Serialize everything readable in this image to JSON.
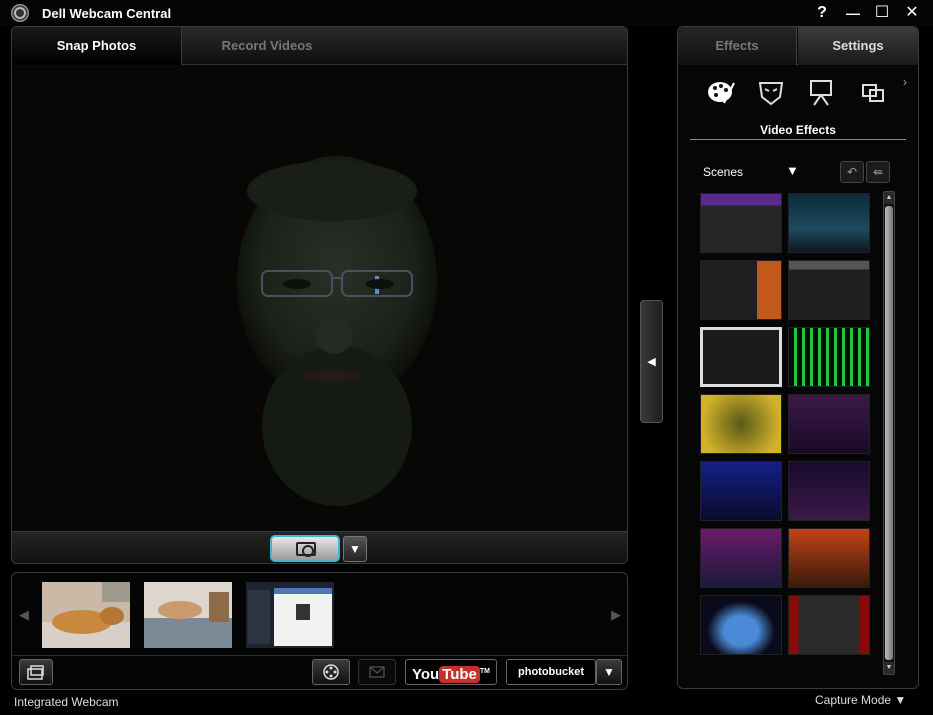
{
  "window": {
    "title": "Dell Webcam Central",
    "controls": [
      "?",
      "—",
      "☐",
      "✕"
    ]
  },
  "capture": {
    "tabs": [
      {
        "label": "Snap Photos"
      },
      {
        "label": "Record Videos"
      }
    ],
    "snap_dropdown": "▼"
  },
  "gallery": {
    "prev_arrow": "◀",
    "next_arrow": "▶",
    "youtube_you": "You",
    "youtube_tube": "Tube",
    "youtube_tm": "TM",
    "photobucket_label": "photobucket",
    "share_dropdown": "▼"
  },
  "collapse_arrow": "◀",
  "effects": {
    "tabs": [
      {
        "label": "Effects"
      },
      {
        "label": "Settings"
      }
    ],
    "more_arrow": "›",
    "section_title": "Video Effects",
    "category": "Scenes",
    "category_arrow": "▼",
    "undo_icon": "↶",
    "apply_icon": "⇚"
  },
  "status": {
    "source": "Integrated Webcam",
    "mode": "Capture Mode",
    "mode_arrow": "▼"
  },
  "colors": {
    "accent": "#3fb6d6",
    "background": "#000000",
    "youtube_red": "#c4302b"
  }
}
